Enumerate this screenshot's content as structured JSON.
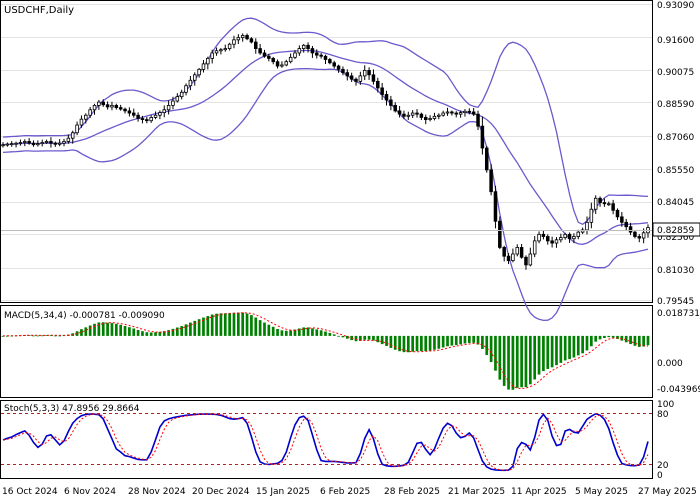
{
  "header": {
    "symbol_label": "USDCHF,Daily"
  },
  "price_panel": {
    "ticks": [
      "0.93090",
      "0.91600",
      "0.90075",
      "0.88590",
      "0.87060",
      "0.85550",
      "0.84045",
      "0.82560",
      "0.81030",
      "0.79545"
    ],
    "current_price": "0.82859",
    "colors": {
      "bands": "#6a5acd",
      "candles": "#000000",
      "grid": "#c8c8c8",
      "price_line": "#bdbdbd"
    }
  },
  "macd_panel": {
    "label": "MACD(5,34,4) -0.000781 -0.009090",
    "ticks": [
      "0.018731",
      "0.000",
      "-0.043969"
    ],
    "colors": {
      "histogram": "#008000",
      "signal": "#ff0000"
    }
  },
  "stoch_panel": {
    "label": "Stoch(5,3,3) 47.8956 29.8664",
    "ticks": [
      "100",
      "80",
      "20",
      "0"
    ],
    "colors": {
      "main": "#0000cd",
      "signal": "#ff0000",
      "levels": "#b22222"
    }
  },
  "x_axis": {
    "labels": [
      "16 Oct 2024",
      "6 Nov 2024",
      "28 Nov 2024",
      "20 Dec 2024",
      "15 Jan 2025",
      "6 Feb 2025",
      "28 Feb 2025",
      "21 Mar 2025",
      "11 Apr 2025",
      "5 May 2025",
      "27 May 2025"
    ]
  },
  "chart_data": {
    "type": "candlestick",
    "symbol": "USDCHF",
    "timeframe": "Daily",
    "y_range": [
      0.79545,
      0.9309
    ],
    "last_close": 0.82859,
    "closes": [
      0.8665,
      0.8668,
      0.867,
      0.8672,
      0.8675,
      0.868,
      0.8672,
      0.8665,
      0.867,
      0.8675,
      0.868,
      0.8672,
      0.8667,
      0.8672,
      0.868,
      0.8695,
      0.872,
      0.8755,
      0.8782,
      0.88,
      0.8825,
      0.8845,
      0.886,
      0.8848,
      0.8838,
      0.8845,
      0.8835,
      0.8828,
      0.882,
      0.881,
      0.88,
      0.8785,
      0.878,
      0.8775,
      0.879,
      0.88,
      0.8812,
      0.8825,
      0.8845,
      0.8865,
      0.8885,
      0.8905,
      0.8935,
      0.896,
      0.8985,
      0.901,
      0.9035,
      0.906,
      0.9085,
      0.9095,
      0.91,
      0.9105,
      0.9125,
      0.9145,
      0.9155,
      0.9165,
      0.915,
      0.9135,
      0.9105,
      0.9085,
      0.907,
      0.906,
      0.9045,
      0.9025,
      0.903,
      0.9045,
      0.9065,
      0.9085,
      0.9105,
      0.912,
      0.9105,
      0.9085,
      0.9075,
      0.907,
      0.9055,
      0.904,
      0.9025,
      0.901,
      0.8995,
      0.898,
      0.8965,
      0.8955,
      0.898,
      0.9005,
      0.8985,
      0.8955,
      0.8925,
      0.8895,
      0.887,
      0.8845,
      0.882,
      0.8805,
      0.8795,
      0.88,
      0.881,
      0.8805,
      0.879,
      0.878,
      0.8785,
      0.8795,
      0.88,
      0.881,
      0.8815,
      0.881,
      0.8805,
      0.8812,
      0.8818,
      0.8815,
      0.8805,
      0.875,
      0.865,
      0.855,
      0.845,
      0.8315,
      0.8195,
      0.8155,
      0.8135,
      0.8165,
      0.8195,
      0.815,
      0.8115,
      0.8165,
      0.8225,
      0.8255,
      0.8245,
      0.8225,
      0.8215,
      0.823,
      0.824,
      0.8255,
      0.8235,
      0.8245,
      0.8265,
      0.8275,
      0.831,
      0.837,
      0.842,
      0.84,
      0.8395,
      0.8395,
      0.8365,
      0.8335,
      0.831,
      0.829,
      0.8265,
      0.8245,
      0.8238,
      0.8262,
      0.8286
    ]
  }
}
